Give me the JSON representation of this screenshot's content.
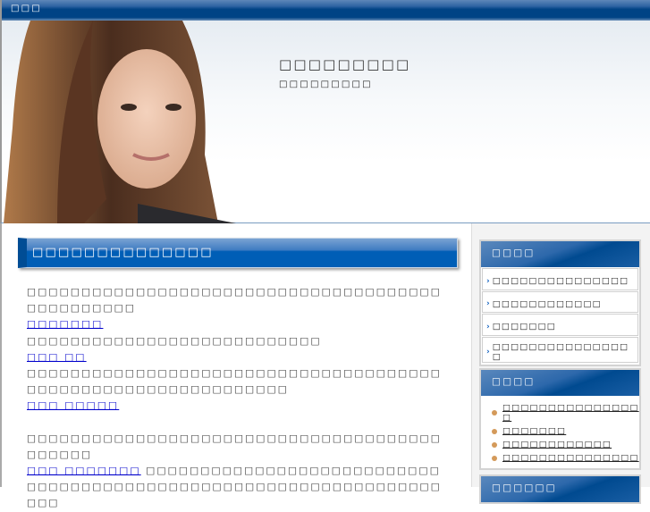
{
  "topbar": {
    "label": "□□□"
  },
  "header": {
    "title": "□□□□□□□□□",
    "subtitle": "□□□□□□□□□"
  },
  "main": {
    "heading": "□□□□□□□□□□□□□□",
    "p1": "□□□□□□□□□□□□□□□□□□□□□□□□□□□□□□□□□□□□□□□□□□□□□□□□",
    "link1": "□□□□□□□",
    "p2": "□□□□□□□□□□□□□□□□□□□□□□□□□□□",
    "link2": "□□□ □□",
    "p3": "□□□□□□□□□□□□□□□□□□□□□□□□□□□□□□□□□□□□□□□□□□□□□□□□□□□□□□□□□□□□□□",
    "link3": "□□□ □□□□□",
    "p4": "□□□□□□□□□□□□□□□□□□□□□□□□□□□□□□□□□□□□□□□□□□□□",
    "link4": "□□□ □□□□□□□",
    "p5": "□□□□□□□□□□□□□□□□□□□□□□□□□□□□□□□□□□□□□□□□□□□□□□□□□□□□□□□□□□□□□□□□□□□□"
  },
  "sidebar": {
    "box1": {
      "title": "□□□□",
      "items": [
        "□□□□□□□□□□□□□□□",
        "□□□□□□□□□□□□",
        "□□□□□□□",
        "□□□□□□□□□□□□□□□□"
      ]
    },
    "box2": {
      "title": "□□□□",
      "links": [
        "□□□□□□□□□□□□□□□□",
        "□□□□□□□",
        "□□□□□□□□□□□□",
        "□□□□□□□□□□□□□□□"
      ]
    },
    "box3": {
      "title": "□□□□□□"
    }
  }
}
